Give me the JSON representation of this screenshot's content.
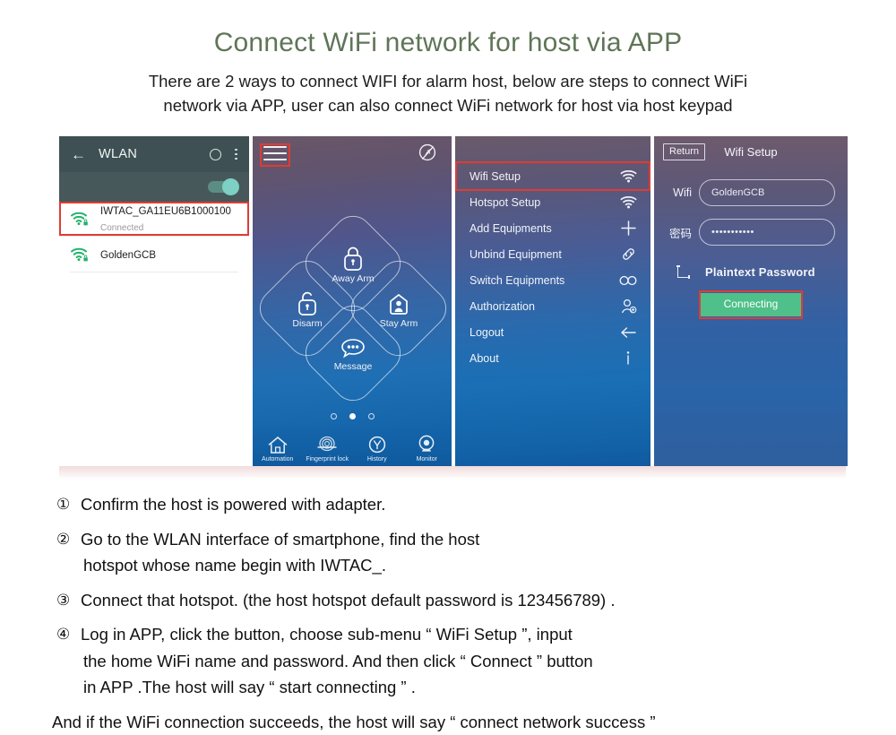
{
  "header": {
    "title": "Connect WiFi network for host via APP",
    "intro_line1": "There are 2 ways to connect WIFI for alarm host, below are steps to connect WiFi",
    "intro_line2": "network via APP, user can also connect WiFi network for host via host keypad",
    "title_color": "#5f7557"
  },
  "panels": {
    "wlan": {
      "back_icon": "back-arrow-icon",
      "title": "WLAN",
      "circle_icon": "circle-icon",
      "overflow_icon": "overflow-menu-icon",
      "toggle_state": "on",
      "networks": [
        {
          "name": "IWTAC_GA11EU6B1000100",
          "status": "Connected",
          "icon": "wifi-secured-icon",
          "highlighted": true
        },
        {
          "name": "GoldenGCB",
          "status": "",
          "icon": "wifi-secured-icon",
          "highlighted": false
        }
      ],
      "highlight_color": "#e03b34"
    },
    "home": {
      "menu_icon": "hamburger-menu-icon",
      "mute_icon": "notification-off-icon",
      "menu_highlighted": true,
      "actions": [
        {
          "label": "Away Arm",
          "icon": "padlock-closed-icon",
          "position": "top"
        },
        {
          "label": "Disarm",
          "icon": "padlock-open-icon",
          "position": "left"
        },
        {
          "label": "Stay Arm",
          "icon": "person-home-icon",
          "position": "right"
        },
        {
          "label": "Message",
          "icon": "chat-bubble-icon",
          "position": "bottom"
        }
      ],
      "page_dots": {
        "count": 3,
        "active_index": 1
      },
      "tabs": [
        {
          "label": "Automation",
          "icon": "house-icon"
        },
        {
          "label": "Fingerprint lock",
          "icon": "fingerprint-icon"
        },
        {
          "label": "History",
          "icon": "clock-icon"
        },
        {
          "label": "Monitor",
          "icon": "camera-icon"
        }
      ]
    },
    "menu": {
      "items": [
        {
          "label": "Wifi Setup",
          "icon": "wifi-icon",
          "highlighted": true
        },
        {
          "label": "Hotspot Setup",
          "icon": "wifi-icon",
          "highlighted": false
        },
        {
          "label": "Add Equipments",
          "icon": "plus-icon",
          "highlighted": false
        },
        {
          "label": "Unbind Equipment",
          "icon": "link-icon",
          "highlighted": false
        },
        {
          "label": "Switch Equipments",
          "icon": "infinity-icon",
          "highlighted": false
        },
        {
          "label": "Authorization",
          "icon": "add-user-icon",
          "highlighted": false
        },
        {
          "label": "Logout",
          "icon": "left-arrow-icon",
          "highlighted": false
        },
        {
          "label": "About",
          "icon": "info-icon",
          "highlighted": false
        }
      ]
    },
    "wifi_setup": {
      "return_label": "Return",
      "title": "Wifi Setup",
      "wifi_label": "Wifi",
      "wifi_value": "GoldenGCB",
      "password_label": "密码",
      "password_value": "•••••••••••",
      "plaintext_label": "Plaintext Password",
      "plaintext_checked": false,
      "connect_label": "Connecting",
      "connect_color": "#4fc08a",
      "connect_highlighted": true
    }
  },
  "steps": [
    {
      "num": "①",
      "lines": [
        "Confirm the host is powered with adapter."
      ]
    },
    {
      "num": "②",
      "lines": [
        "Go to the WLAN interface of smartphone, find the host",
        "hotspot whose name begin with IWTAC_."
      ]
    },
    {
      "num": "③",
      "lines": [
        "Connect that hotspot. (the host hotspot default password is 123456789) ."
      ]
    },
    {
      "num": "④",
      "lines": [
        "Log in APP, click the      button, choose sub-menu “ WiFi Setup ”, input",
        "the home WiFi name and password. And then click “ Connect ” button",
        "in APP .The host will say “  start connecting ” ."
      ]
    }
  ],
  "closing_note": "And if the WiFi connection succeeds, the host will say “ connect network success ”"
}
